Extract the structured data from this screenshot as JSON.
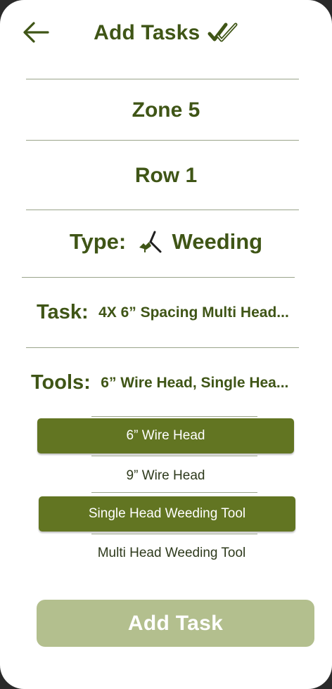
{
  "header": {
    "title": "Add Tasks"
  },
  "zone": "Zone 5",
  "row": "Row 1",
  "type": {
    "label": "Type:",
    "value": "Weeding",
    "icon": "hoe-icon"
  },
  "task": {
    "label": "Task:",
    "value": "4X 6” Spacing Multi Head..."
  },
  "tools": {
    "label": "Tools:",
    "value": "6” Wire Head, Single Hea...",
    "options": [
      {
        "label": "6” Wire Head",
        "selected": true
      },
      {
        "label": "9” Wire Head",
        "selected": false
      },
      {
        "label": "Single Head Weeding Tool",
        "selected": true
      },
      {
        "label": "Multi Head Weeding Tool",
        "selected": false
      }
    ]
  },
  "add_button": {
    "label": "Add Task"
  },
  "colors": {
    "text_green": "#3f5516",
    "selected_bg": "#627522",
    "button_bg": "#b3bf8e",
    "divider": "#9aa48a"
  }
}
